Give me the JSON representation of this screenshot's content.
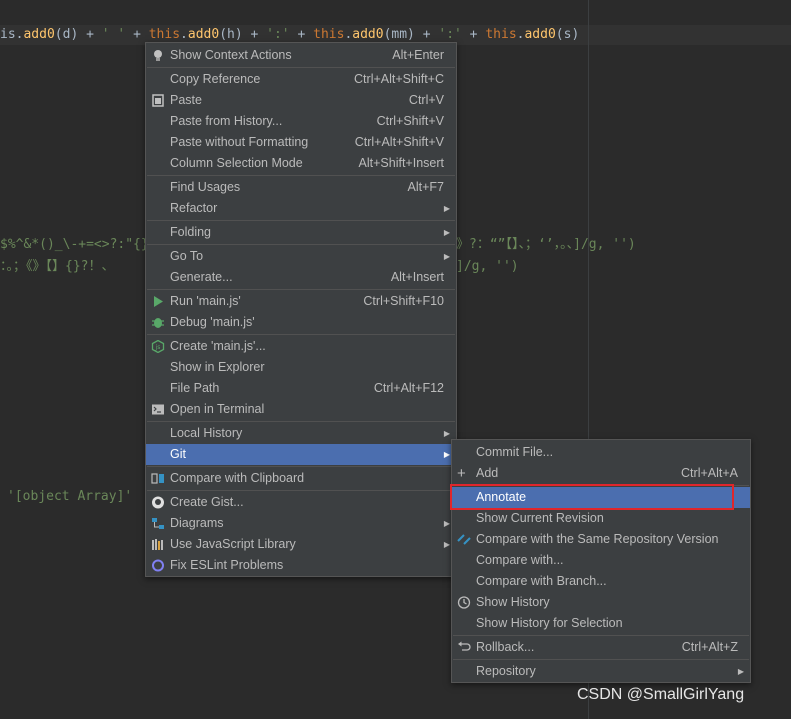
{
  "editor": {
    "line1": {
      "p1": "is.",
      "f1": "add0",
      "p2": "(d) + ",
      "s1": "' '",
      "p3": " + ",
      "k1": "this",
      "p4": ".",
      "f2": "add0",
      "p5": "(h) + ",
      "s2": "':'",
      "p6": " + ",
      "k2": "this",
      "p7": ".",
      "f3": "add0",
      "p8": "(mm) + ",
      "s3": "':'",
      "p9": " + ",
      "k3": "this",
      "p10": ".",
      "f4": "add0",
      "p11": "(s)"
    },
    "line2_left": "$%^&*()_\\-+=<>?:\"{}",
    "line2_right": "》?：“”【】、；‘’，。、]/g, '')",
    "line3_left": "：。；《》【】{}?！、",
    "line3_right": "]/g, '')",
    "line4": "'[object Array]'"
  },
  "context_menu": {
    "items": [
      {
        "label": "Show Context Actions",
        "shortcut": "Alt+Enter",
        "icon": "bulb-icon"
      },
      {
        "label": "Copy Reference",
        "shortcut": "Ctrl+Alt+Shift+C"
      },
      {
        "label": "Paste",
        "shortcut": "Ctrl+V",
        "icon": "clipboard-icon"
      },
      {
        "label": "Paste from History...",
        "shortcut": "Ctrl+Shift+V"
      },
      {
        "label": "Paste without Formatting",
        "shortcut": "Ctrl+Alt+Shift+V"
      },
      {
        "label": "Column Selection Mode",
        "shortcut": "Alt+Shift+Insert"
      },
      {
        "label": "Find Usages",
        "shortcut": "Alt+F7"
      },
      {
        "label": "Refactor",
        "shortcut": ""
      },
      {
        "label": "Folding",
        "shortcut": ""
      },
      {
        "label": "Go To",
        "shortcut": ""
      },
      {
        "label": "Generate...",
        "shortcut": "Alt+Insert"
      },
      {
        "label": "Run 'main.js'",
        "shortcut": "Ctrl+Shift+F10",
        "icon": "run-icon"
      },
      {
        "label": "Debug 'main.js'",
        "shortcut": "",
        "icon": "debug-icon"
      },
      {
        "label": "Create 'main.js'...",
        "shortcut": "",
        "icon": "nodejs-icon"
      },
      {
        "label": "Show in Explorer",
        "shortcut": ""
      },
      {
        "label": "File Path",
        "shortcut": "Ctrl+Alt+F12"
      },
      {
        "label": "Open in Terminal",
        "shortcut": "",
        "icon": "terminal-icon"
      },
      {
        "label": "Local History",
        "shortcut": ""
      },
      {
        "label": "Git",
        "shortcut": ""
      },
      {
        "label": "Compare with Clipboard",
        "shortcut": "",
        "icon": "compare-icon"
      },
      {
        "label": "Create Gist...",
        "shortcut": "",
        "icon": "github-icon"
      },
      {
        "label": "Diagrams",
        "shortcut": "",
        "icon": "diagrams-icon"
      },
      {
        "label": "Use JavaScript Library",
        "shortcut": "",
        "icon": "library-icon"
      },
      {
        "label": "Fix ESLint Problems",
        "shortcut": "",
        "icon": "eslint-icon"
      }
    ]
  },
  "git_submenu": {
    "items": [
      {
        "label": "Commit File...",
        "shortcut": ""
      },
      {
        "label": "Add",
        "shortcut": "Ctrl+Alt+A",
        "icon": "plus-icon"
      },
      {
        "label": "Annotate",
        "shortcut": ""
      },
      {
        "label": "Show Current Revision",
        "shortcut": ""
      },
      {
        "label": "Compare with the Same Repository Version",
        "shortcut": "",
        "icon": "compare-icon"
      },
      {
        "label": "Compare with...",
        "shortcut": ""
      },
      {
        "label": "Compare with Branch...",
        "shortcut": ""
      },
      {
        "label": "Show History",
        "shortcut": "",
        "icon": "history-icon"
      },
      {
        "label": "Show History for Selection",
        "shortcut": ""
      },
      {
        "label": "Rollback...",
        "shortcut": "Ctrl+Alt+Z",
        "icon": "rollback-icon"
      },
      {
        "label": "Repository",
        "shortcut": ""
      }
    ]
  },
  "watermark": "CSDN @SmallGirlYang",
  "colors": {
    "menu_bg": "#3c3f41",
    "selection": "#4b6eaf",
    "editor_bg": "#2b2b2b",
    "highlight_box": "#e0262b"
  }
}
